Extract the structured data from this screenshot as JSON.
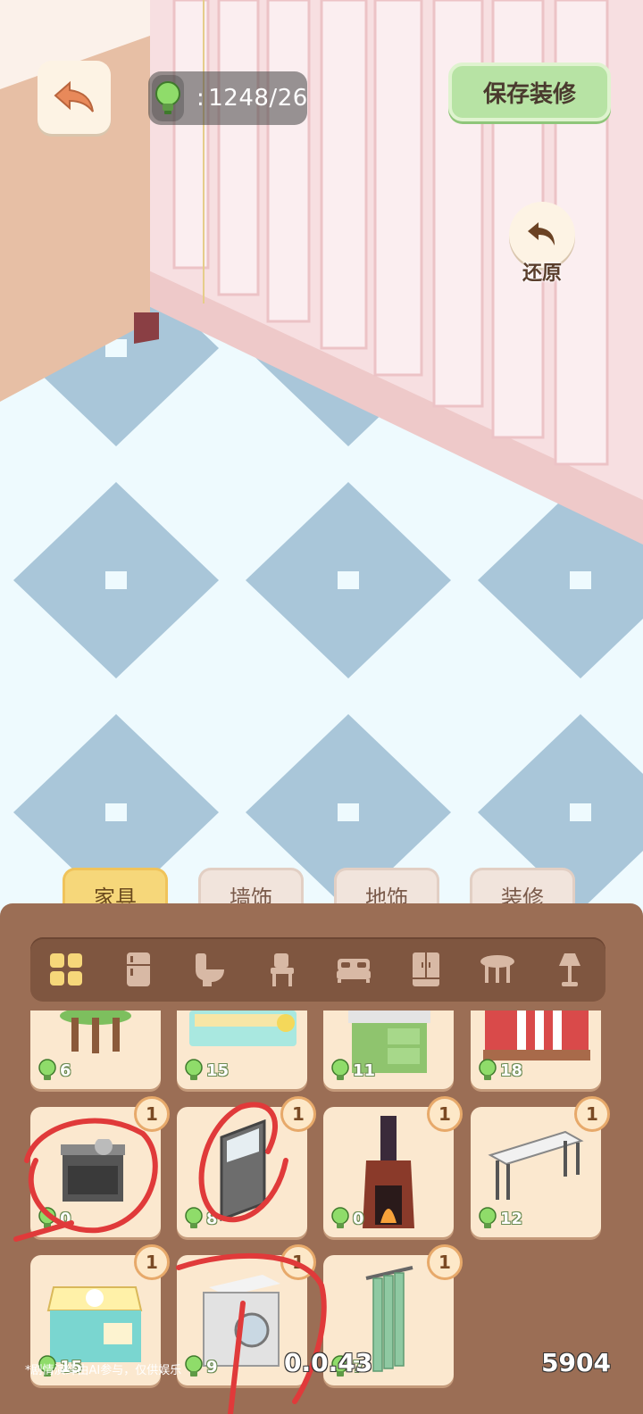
{
  "hud": {
    "energy_value": "1248/26",
    "save_label": "保存装修",
    "restore_label": "还原"
  },
  "tabs": [
    {
      "label": "家具",
      "active": true
    },
    {
      "label": "墙饰",
      "active": false
    },
    {
      "label": "地饰",
      "active": false
    },
    {
      "label": "装修",
      "active": false
    }
  ],
  "categories": [
    "all-icon",
    "fridge-icon",
    "toilet-icon",
    "chair-icon",
    "bed-icon",
    "wardrobe-icon",
    "table-icon",
    "lamp-icon"
  ],
  "items": [
    {
      "name": "stool",
      "cost": "6",
      "count": ""
    },
    {
      "name": "counter",
      "cost": "15",
      "count": ""
    },
    {
      "name": "stove-cabinet",
      "cost": "11",
      "count": ""
    },
    {
      "name": "bed",
      "cost": "18",
      "count": ""
    },
    {
      "name": "stove",
      "cost": "0",
      "count": "1"
    },
    {
      "name": "door",
      "cost": "8",
      "count": "1"
    },
    {
      "name": "fireplace",
      "cost": "0",
      "count": "1"
    },
    {
      "name": "bench",
      "cost": "12",
      "count": "1"
    },
    {
      "name": "cake-box",
      "cost": "15",
      "count": "1"
    },
    {
      "name": "washing-machine",
      "cost": "9",
      "count": "1"
    },
    {
      "name": "curtain",
      "cost": "7",
      "count": "1"
    }
  ],
  "footer": {
    "note": "*剧情演绎由AI参与，仅供娱乐",
    "version": "0.0.43",
    "id": "5904"
  },
  "colors": {
    "floor_light": "#eefafe",
    "floor_tile": "#a9c6d9",
    "wall": "#f7dfe1",
    "panel": "#9b6e55",
    "accent_green": "#b7e3a4",
    "tab_active": "#f6d77a"
  }
}
